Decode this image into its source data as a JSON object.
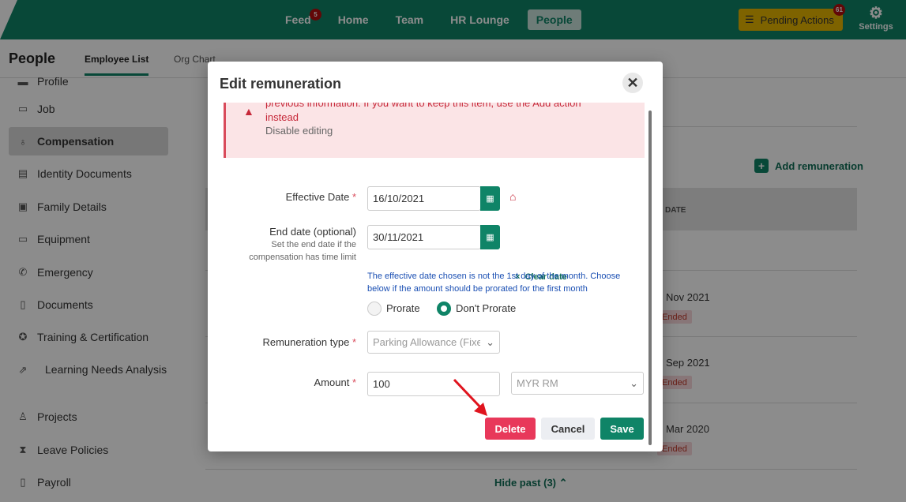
{
  "topbar": {
    "nav": [
      {
        "label": "Feed",
        "badge": "5"
      },
      {
        "label": "Home"
      },
      {
        "label": "Team"
      },
      {
        "label": "HR Lounge"
      },
      {
        "label": "People"
      }
    ],
    "pending_label": "Pending Actions",
    "pending_badge": "61",
    "settings_label": "Settings"
  },
  "subhead": {
    "title": "People",
    "tabs": [
      "Employee List",
      "Org Chart"
    ]
  },
  "sidebar": {
    "items": [
      {
        "label": "Profile",
        "icon": "profile-icon"
      },
      {
        "label": "Job",
        "icon": "briefcase-icon"
      },
      {
        "label": "Compensation",
        "icon": "money-bag-icon"
      },
      {
        "label": "Identity Documents",
        "icon": "id-card-icon"
      },
      {
        "label": "Family Details",
        "icon": "family-icon"
      },
      {
        "label": "Equipment",
        "icon": "laptop-icon"
      },
      {
        "label": "Emergency",
        "icon": "phone-icon"
      },
      {
        "label": "Documents",
        "icon": "document-icon"
      },
      {
        "label": "Training & Certification",
        "icon": "certificate-icon"
      },
      {
        "label": "Learning Needs Analysis",
        "icon": "chart-icon"
      },
      {
        "label": "Projects",
        "icon": "person-icon"
      },
      {
        "label": "Leave Policies",
        "icon": "hourglass-icon"
      },
      {
        "label": "Payroll",
        "icon": "payroll-icon"
      }
    ]
  },
  "main": {
    "add_label": "Add remuneration",
    "col_header": "D DATE",
    "rows": [
      {
        "date": "Nov 2021",
        "status": "Ended"
      },
      {
        "date": "Sep 2021",
        "status": "Ended"
      },
      {
        "date": "Mar 2020",
        "status": "Ended"
      }
    ],
    "hide_past": "Hide past (3)"
  },
  "modal": {
    "title": "Edit remuneration",
    "warning_text": "previous information. If you want to keep this item, use the Add action instead",
    "disable_label": "Disable editing",
    "effective_label": "Effective Date",
    "effective_value": "16/10/2021",
    "end_label": "End date (optional)",
    "end_help": "Set the end date if the compensation has time limit",
    "end_value": "30/11/2021",
    "clear_label": "Clear date",
    "info_text": "The effective date chosen is not the 1st day of the month. Choose below if the amount should be prorated for the first month",
    "prorate_label": "Prorate",
    "dont_prorate_label": "Don't Prorate",
    "prorate_selected": "Don't Prorate",
    "type_label": "Remuneration type",
    "type_value": "Parking Allowance (Fixed)",
    "amount_label": "Amount",
    "amount_value": "100",
    "currency_value": "MYR RM",
    "buttons": {
      "delete": "Delete",
      "cancel": "Cancel",
      "save": "Save"
    }
  },
  "colors": {
    "brand": "#0f8467",
    "danger": "#e8385a",
    "pending": "#e6b400"
  }
}
